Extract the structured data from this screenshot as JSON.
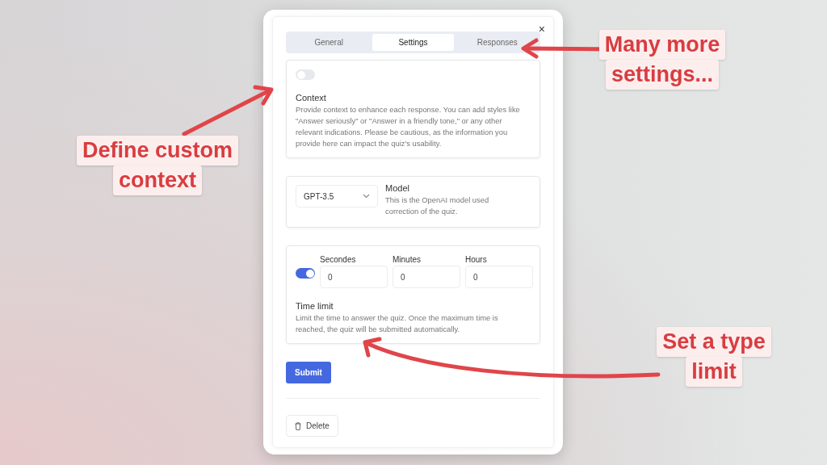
{
  "tabs": [
    {
      "label": "General",
      "selected": false
    },
    {
      "label": "Settings",
      "selected": true
    },
    {
      "label": "Responses",
      "selected": false
    }
  ],
  "close": "×",
  "context": {
    "on": false,
    "title": "Context",
    "description": "Provide context to enhance each response. You can add styles like \"Answer seriously\" or \"Answer in a friendly tone,\" or any other relevant indications. Please be cautious, as the information you provide here can impact the quiz's usability."
  },
  "model": {
    "value": "GPT-3.5",
    "title": "Model",
    "description": "This is the OpenAI model used correction of the quiz."
  },
  "time_limit": {
    "on": true,
    "fields": [
      {
        "label": "Secondes",
        "value": "0"
      },
      {
        "label": "Minutes",
        "value": "0"
      },
      {
        "label": "Hours",
        "value": "0"
      }
    ],
    "title": "Time limit",
    "description": "Limit the time to answer the quiz. Once the maximum time is reached, the quiz will be submitted automatically."
  },
  "submit": "Submit",
  "delete": "Delete",
  "annotations": [
    {
      "lines": [
        "Define custom",
        "context"
      ]
    },
    {
      "lines": [
        "Many more",
        "settings..."
      ]
    },
    {
      "lines": [
        "Set a type",
        "limit"
      ]
    }
  ]
}
